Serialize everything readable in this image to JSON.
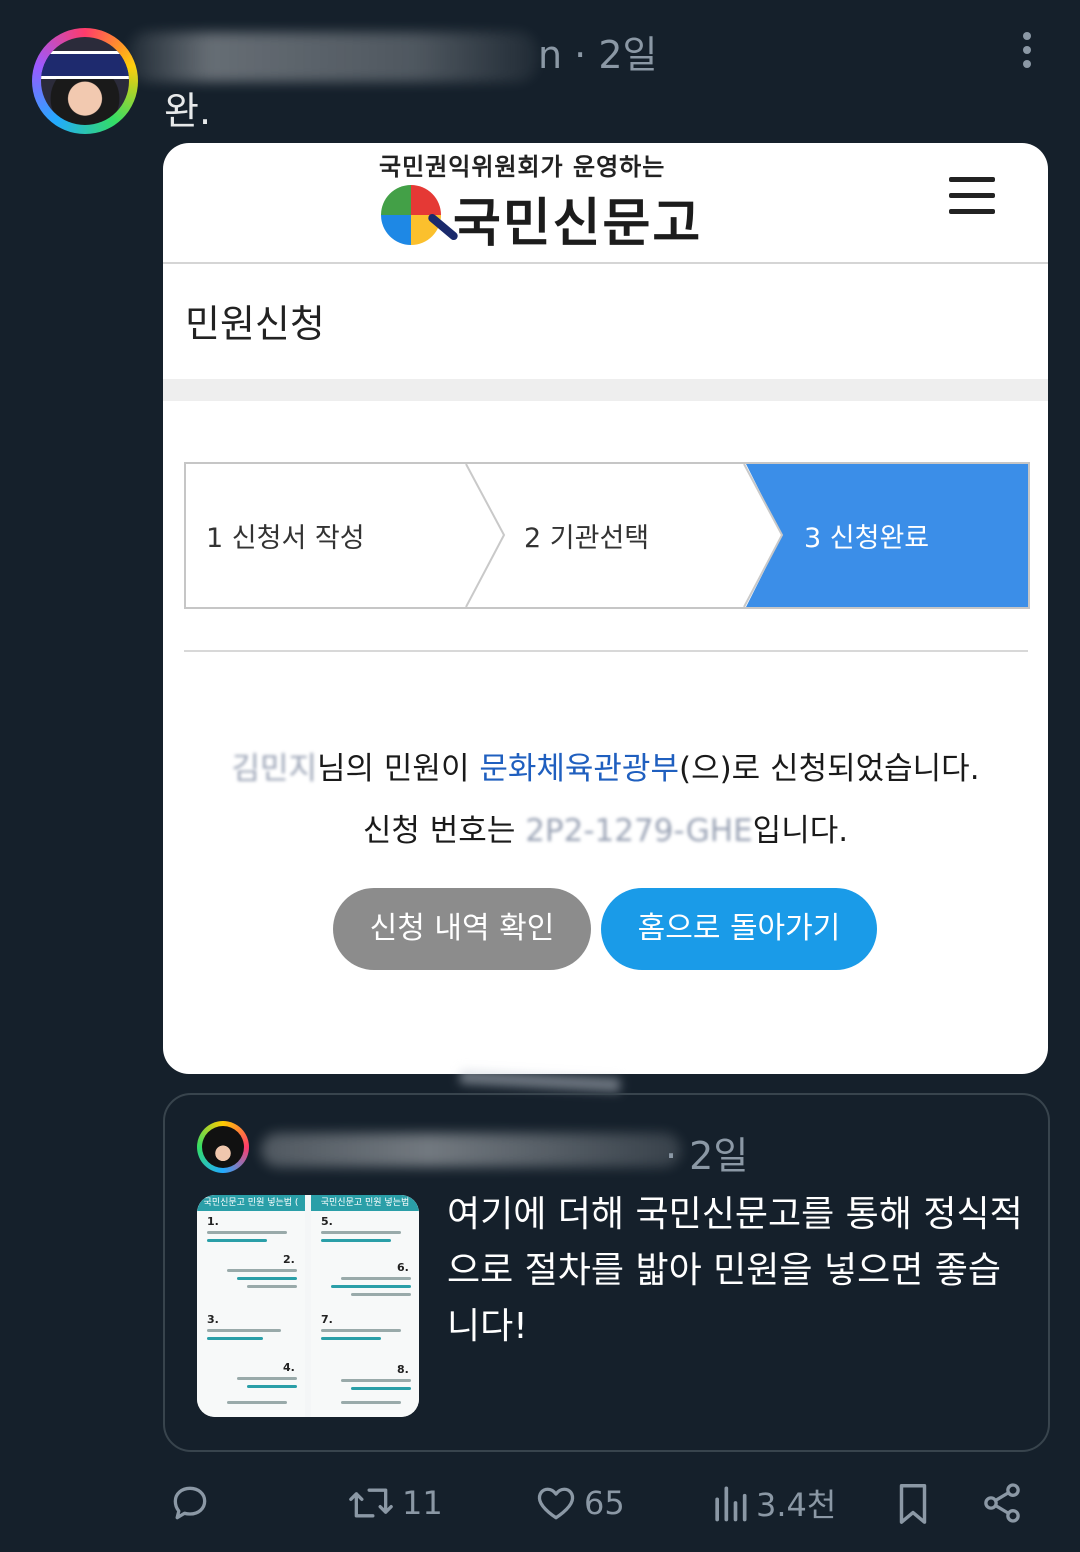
{
  "post": {
    "time": "n · 2일",
    "text": "완."
  },
  "site": {
    "subtitle": "국민권익위원회가 운영하는",
    "logo_text": "국민신문고"
  },
  "page": {
    "title": "민원신청"
  },
  "steps": [
    {
      "label": "1 신청서 작성",
      "active": false
    },
    {
      "label": "2 기관선택",
      "active": false
    },
    {
      "label": "3 신청완료",
      "active": true
    }
  ],
  "message": {
    "name_redacted": "김민지",
    "line1_mid": "님의 민원이 ",
    "agency": "문화체육관광부",
    "line1_end": "(으)로 신청되었습니다.",
    "line2_start": "신청 번호는 ",
    "number_redacted": "2P2-1279-GHE",
    "line2_end": "입니다."
  },
  "buttons": {
    "history": "신청 내역 확인",
    "home": "홈으로 돌아가기"
  },
  "quote": {
    "time": "· 2일",
    "text": "여기에 더해 국민신문고를 통해 정식적으로 절차를 밟아 민원을 넣으면 좋습니다!",
    "thumb_header_left": "국민신문고 민원 넣는법 (",
    "thumb_header_right": "국민신문고 민원 넣는법",
    "thumb_steps": [
      "1.",
      "2.",
      "3.",
      "4.",
      "5.",
      "6.",
      "7.",
      "8."
    ]
  },
  "actions": {
    "reply_icon": "reply-icon",
    "retweets": "11",
    "likes": "65",
    "views": "3.4천"
  },
  "colors": {
    "background": "#15202b",
    "step_active": "#3b8ee8",
    "home_button": "#1a9be8",
    "history_button": "#8c8c8c",
    "agency_link": "#1f5fbf"
  }
}
